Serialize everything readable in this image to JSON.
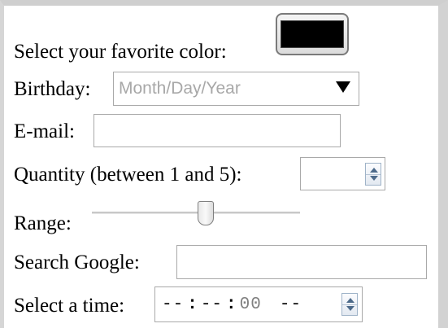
{
  "form": {
    "color": {
      "label": "Select your favorite color:",
      "value": "#000000"
    },
    "birthday": {
      "label": "Birthday:",
      "placeholder": "Month/Day/Year"
    },
    "email": {
      "label": "E-mail:",
      "value": ""
    },
    "quantity": {
      "label": "Quantity (between 1 and 5):",
      "value": ""
    },
    "range": {
      "label": "Range:",
      "value_fraction": 0.55
    },
    "search": {
      "label": "Search Google:",
      "value": ""
    },
    "time": {
      "label": "Select a time:",
      "hours": "--",
      "minutes": "--",
      "seconds": "00",
      "period": "--"
    }
  },
  "icons": {
    "dropdown": "dropdown-arrow-icon",
    "spinner_up": "spin-up-icon",
    "spinner_down": "spin-down-icon"
  }
}
